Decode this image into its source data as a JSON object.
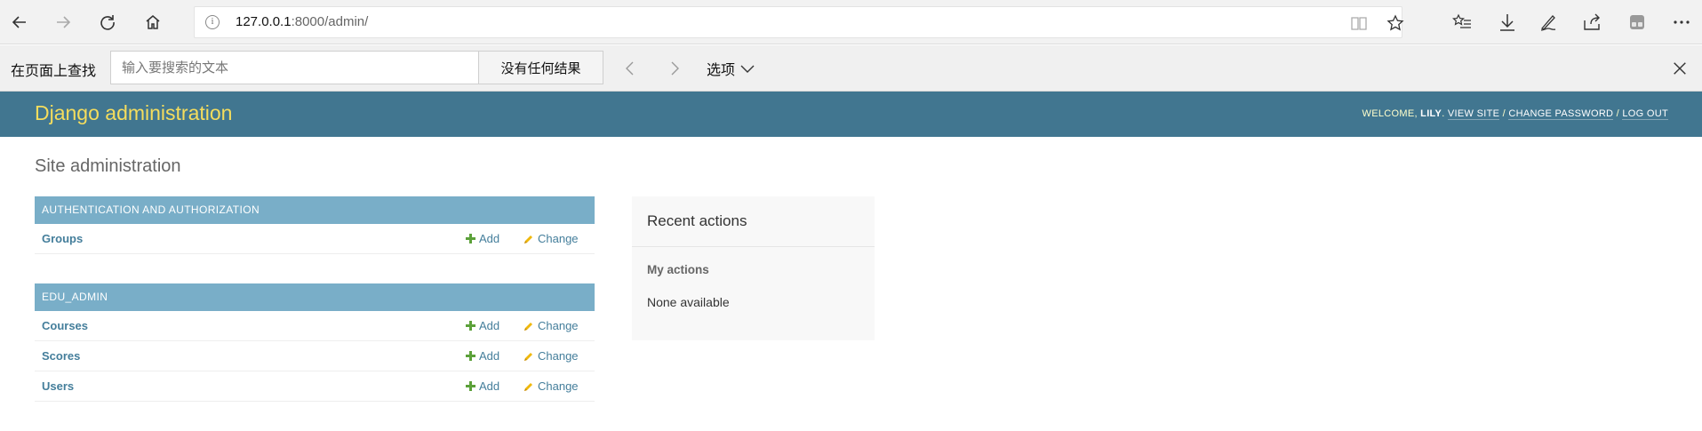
{
  "browser": {
    "url_host": "127.0.0.1",
    "url_rest": ":8000/admin/",
    "icons": [
      "back-icon",
      "forward-icon",
      "refresh-icon",
      "home-icon",
      "info-icon",
      "reading-view-icon",
      "favorite-star-icon",
      "favorites-list-icon",
      "download-icon",
      "pen-icon",
      "share-icon",
      "extension-icon",
      "more-icon"
    ]
  },
  "find_bar": {
    "label": "在页面上查找",
    "placeholder": "输入要搜索的文本",
    "result": "没有任何结果",
    "options_label": "选项"
  },
  "header": {
    "branding": "Django administration",
    "welcome": "Welcome, ",
    "username": "lily",
    "dot": ". ",
    "view_site": "View site",
    "sep1": " / ",
    "change_password": "Change password",
    "sep2": " / ",
    "log_out": "Log out"
  },
  "content": {
    "title": "Site administration",
    "apps": [
      {
        "name": "Authentication and Authorization",
        "models": [
          {
            "name": "Groups",
            "add": "Add",
            "change": "Change"
          }
        ]
      },
      {
        "name": "EDU_ADMIN",
        "models": [
          {
            "name": "Courses",
            "add": "Add",
            "change": "Change"
          },
          {
            "name": "Scores",
            "add": "Add",
            "change": "Change"
          },
          {
            "name": "Users",
            "add": "Add",
            "change": "Change"
          }
        ]
      }
    ]
  },
  "recent_actions": {
    "title": "Recent actions",
    "subtitle": "My actions",
    "empty": "None available"
  },
  "colors": {
    "header_bg": "#417690",
    "branding": "#f5dd5d",
    "caption_bg": "#79aec8",
    "link": "#447e9b",
    "add_green": "#5ca13a",
    "change_yellow": "#efb80b"
  }
}
